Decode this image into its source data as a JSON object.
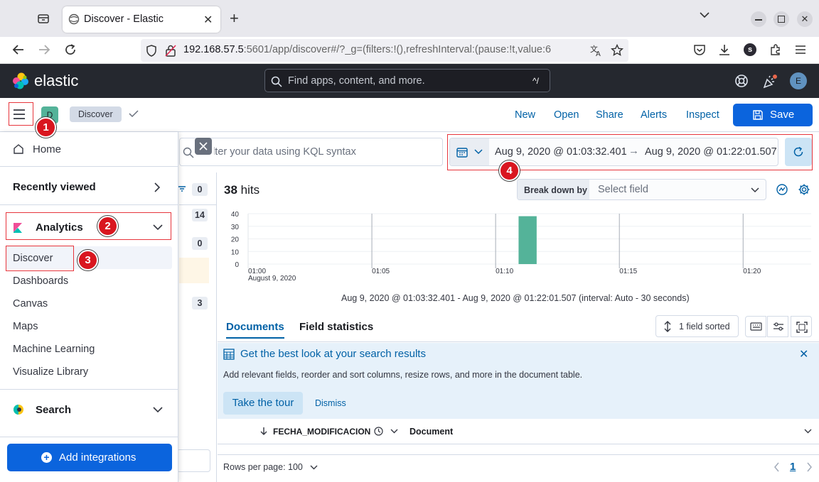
{
  "browser": {
    "tab_title": "Discover - Elastic",
    "url_host": "192.168.57.5",
    "url_rest": ":5601/app/discover#/?_g=(filters:!(),refreshInterval:(pause:!t,value:6"
  },
  "kibana_header": {
    "brand": "elastic",
    "search_placeholder": "Find apps, content, and more.",
    "search_shortcut": "^/",
    "avatar_initial": "E"
  },
  "subheader": {
    "space_initial": "D",
    "breadcrumb": "Discover",
    "links": [
      "New",
      "Open",
      "Share",
      "Alerts",
      "Inspect"
    ],
    "save_label": "Save"
  },
  "sidenav": {
    "home": "Home",
    "recently_viewed": "Recently viewed",
    "analytics": "Analytics",
    "analytics_items": [
      "Discover",
      "Dashboards",
      "Canvas",
      "Maps",
      "Machine Learning",
      "Visualize Library"
    ],
    "search": "Search",
    "add_integrations": "Add integrations"
  },
  "annotations": [
    "1",
    "2",
    "3",
    "4"
  ],
  "query": {
    "placeholder": "Filter your data using KQL syntax"
  },
  "time": {
    "start": "Aug 9, 2020 @ 01:03:32.401",
    "arrow": "→",
    "end": "Aug 9, 2020 @ 01:22:01.507"
  },
  "sidebar_counts": [
    "0",
    "14",
    "0",
    "3"
  ],
  "results": {
    "hits_count": "38",
    "hits_label": "hits",
    "breakdown_label": "Break down by",
    "breakdown_placeholder": "Select field",
    "interval_caption": "Aug 9, 2020 @ 01:03:32.401 - Aug 9, 2020 @ 01:22:01.507 (interval: Auto - 30 seconds)"
  },
  "chart_data": {
    "type": "bar",
    "x_tick_labels": [
      "01:00",
      "01:05",
      "01:10",
      "01:15",
      "01:20"
    ],
    "x_subtitle": "August 9, 2020",
    "y_ticks": [
      0,
      10,
      20,
      30,
      40
    ],
    "ylim": [
      0,
      40
    ],
    "bars": [
      {
        "x": "01:11",
        "value": 38
      }
    ],
    "bar_color": "#54b399",
    "grid": true
  },
  "tabs": {
    "documents": "Documents",
    "field_statistics": "Field statistics",
    "sort_label": "1 field sorted"
  },
  "callout": {
    "title": "Get the best look at your search results",
    "body": "Add relevant fields, reorder and sort columns, resize rows, and more in the document table.",
    "tour_button": "Take the tour",
    "dismiss": "Dismiss"
  },
  "grid": {
    "col1": "FECHA_MODIFICACION",
    "col2": "Document"
  },
  "footer": {
    "rows_per_page": "Rows per page: 100",
    "page": "1"
  },
  "colors": {
    "primary": "#0b64dd",
    "link": "#0061a6",
    "header": "#25282f",
    "annotation_red": "#e7353c"
  }
}
